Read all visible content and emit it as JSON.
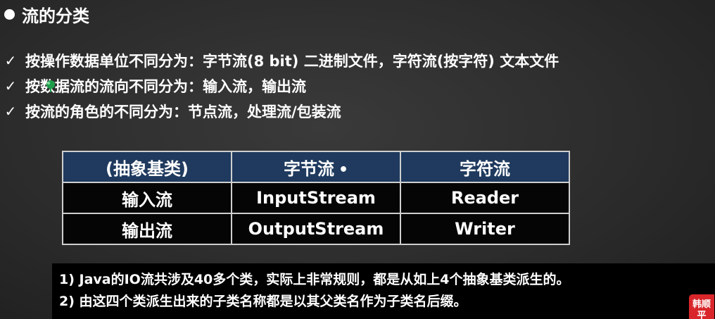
{
  "heading": {
    "text": "流的分类"
  },
  "points": [
    {
      "text": "按操作数据单位不同分为：字节流(8 bit) 二进制文件，字符流(按字符) 文本文件"
    },
    {
      "text": "按数据流的流向不同分为：输入流，输出流"
    },
    {
      "text": "按流的角色的不同分为：节点流，处理流/包装流"
    }
  ],
  "table": {
    "headers": [
      "(抽象基类)",
      "字节流",
      "字符流"
    ],
    "rows": [
      [
        "输入流",
        "InputStream",
        "Reader"
      ],
      [
        "输出流",
        "OutputStream",
        "Writer"
      ]
    ]
  },
  "notes": [
    "1) Java的IO流共涉及40多个类，实际上非常规则，都是从如上4个抽象基类派生的。",
    "2) 由这四个类派生出来的子类名称都是以其父类名作为子类名后缀。"
  ],
  "badge": {
    "text": "韩顺平"
  },
  "colors": {
    "table_header_bg": "#1f3a5e",
    "table_body_bg": "#050505",
    "badge_bg": "#d8262b",
    "cursor": "#1e9e4a"
  }
}
